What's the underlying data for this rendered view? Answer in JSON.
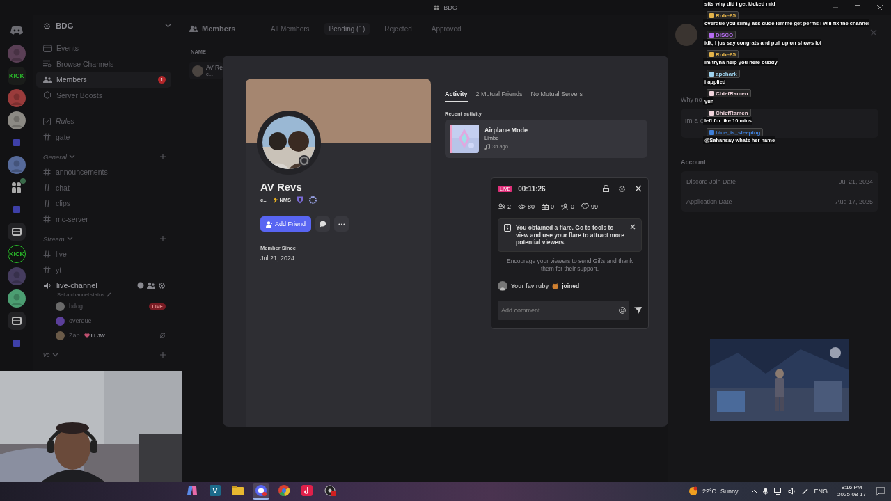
{
  "title_bar": {
    "title": "BDG"
  },
  "server_rail": [
    {
      "kind": "home"
    },
    {
      "kind": "avatar",
      "color": "#5a3f55"
    },
    {
      "kind": "kick",
      "label": "KICK"
    },
    {
      "kind": "avatar",
      "color": "#9a3b3b"
    },
    {
      "kind": "avatar",
      "color": "#8c8a84"
    },
    {
      "kind": "folder",
      "color": "#3e40a8"
    },
    {
      "kind": "avatar",
      "color": "#566a9a"
    },
    {
      "kind": "group"
    },
    {
      "kind": "folder",
      "color": "#3e40a8"
    },
    {
      "kind": "app"
    },
    {
      "kind": "kick",
      "label": "KICK"
    },
    {
      "kind": "avatar",
      "color": "#453c5e"
    },
    {
      "kind": "avatar",
      "color": "#4c9e72"
    },
    {
      "kind": "app"
    },
    {
      "kind": "folder",
      "color": "#3e40a8"
    }
  ],
  "channel_sidebar": {
    "header": "BDG",
    "nav": [
      {
        "kind": "events",
        "label": "Events",
        "selected": false
      },
      {
        "kind": "browse",
        "label": "Browse Channels",
        "selected": false
      },
      {
        "kind": "members",
        "label": "Members",
        "selected": true,
        "badge": "1"
      },
      {
        "kind": "boosts",
        "label": "Server Boosts",
        "selected": false
      }
    ],
    "channels": [
      {
        "kind": "rules",
        "label": "Rules"
      },
      {
        "kind": "text",
        "label": "gate"
      }
    ],
    "categories": [
      {
        "name": "General",
        "channels": [
          {
            "kind": "text",
            "label": "announcements"
          },
          {
            "kind": "text",
            "label": "chat"
          },
          {
            "kind": "text",
            "label": "clips"
          },
          {
            "kind": "text",
            "label": "mc-server"
          }
        ]
      },
      {
        "name": "Stream",
        "channels": [
          {
            "kind": "text",
            "label": "live"
          },
          {
            "kind": "text",
            "label": "yt"
          },
          {
            "kind": "voice",
            "label": "live-channel",
            "status": "Set a channel status",
            "children": [
              {
                "name": "bdog",
                "color": "#6a6a6a",
                "badge": "LIVE"
              },
              {
                "name": "overdue",
                "color": "#5b3f9a"
              },
              {
                "name": "Zap",
                "color": "#6a5a48",
                "tag": "LLJW"
              }
            ]
          }
        ]
      },
      {
        "name": "vc"
      }
    ]
  },
  "members": {
    "header": "Members",
    "tabs": [
      {
        "label": "All Members",
        "selected": false
      },
      {
        "label": "Pending (1)",
        "selected": true
      },
      {
        "label": "Rejected",
        "selected": false
      },
      {
        "label": "Approved",
        "selected": false
      }
    ],
    "table": {
      "columns": [
        "NAME"
      ],
      "rows": [
        {
          "name": "AV Re",
          "subtitle": "c..."
        }
      ]
    }
  },
  "right_panel": {
    "question": "Why no",
    "answer": "im a c",
    "section": "Account",
    "rows": [
      {
        "label": "Discord Join Date",
        "value": "Jul 21, 2024"
      },
      {
        "label": "Application Date",
        "value": "Aug 17, 2025"
      }
    ]
  },
  "profile": {
    "name": "AV Revs",
    "tags": [
      {
        "kind": "text",
        "label": "c..."
      },
      {
        "kind": "clan",
        "label": "NMS"
      }
    ],
    "add_friend": "Add Friend",
    "member_since_label": "Member Since",
    "member_since": "Jul 21, 2024",
    "tabs": [
      {
        "label": "Activity",
        "selected": true
      },
      {
        "label": "2 Mutual Friends",
        "selected": false
      },
      {
        "label": "No Mutual Servers",
        "selected": false
      }
    ],
    "recent_activity_label": "Recent activity",
    "activity": {
      "title": "Airplane Mode",
      "subtitle": "Limbo",
      "time": "3h ago"
    }
  },
  "stream_widget": {
    "live": "LIVE",
    "timer": "00:11:26",
    "stats": [
      {
        "kind": "viewers",
        "value": "2"
      },
      {
        "kind": "views",
        "value": "80"
      },
      {
        "kind": "gifts",
        "value": "0"
      },
      {
        "kind": "follows",
        "value": "0"
      },
      {
        "kind": "likes",
        "value": "99"
      }
    ],
    "notice": "You obtained a flare. Go to tools to view and use your flare to attract more potential viewers.",
    "hint": "Encourage your viewers to send Gifts and thank them for their support.",
    "event": {
      "user": "Your fav ruby",
      "action": "joined"
    },
    "comment": {
      "placeholder": "Add comment"
    }
  },
  "chat_overlay": {
    "lead": "stts why did i get kicked mid",
    "messages": [
      {
        "user": "Robe85",
        "color": "#e3b34a",
        "text": "overdue you slimy ass dude lemme get perms i will fix the channel"
      },
      {
        "user": "DISCO",
        "color": "#b56cf0",
        "text": "idk, I jus say congrats and pull up on shows lol"
      },
      {
        "user": "Robe85",
        "color": "#e3b34a",
        "text": "im tryna help you here buddy"
      },
      {
        "user": "apchark",
        "color": "#9fd4f0",
        "text": "i applied"
      },
      {
        "user": "ChiefRamen",
        "color": "#f0d4dc",
        "text": "yuh"
      },
      {
        "user": "ChiefRamen",
        "color": "#f0d4dc",
        "text": "left for like 10 mins"
      },
      {
        "user": "blue_is_sleeping",
        "color": "#3f7fd8",
        "text": "@Sahansay whats her name"
      }
    ]
  },
  "taskbar": {
    "apps": [
      {
        "kind": "copilot",
        "selected": false
      },
      {
        "kind": "letter",
        "label": "V",
        "selected": false
      },
      {
        "kind": "folder",
        "selected": false
      },
      {
        "kind": "discord",
        "selected": true
      },
      {
        "kind": "chrome",
        "selected": false
      },
      {
        "kind": "tiktok",
        "selected": false
      },
      {
        "kind": "obs",
        "selected": false
      }
    ],
    "weather": {
      "temp": "22°C",
      "condition": "Sunny"
    },
    "language": "ENG",
    "time": "8:16 PM",
    "date": "2025-08-17"
  }
}
